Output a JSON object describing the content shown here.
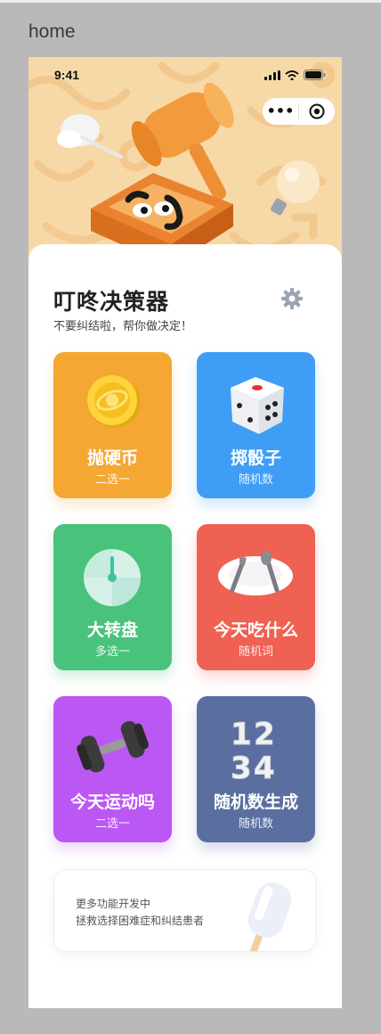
{
  "frame": {
    "label": "home"
  },
  "status_bar": {
    "time": "9:41"
  },
  "capsule": {
    "more_label": "•••"
  },
  "header": {
    "title": "叮咚决策器",
    "subtitle": "不要纠结啦，帮你做决定！"
  },
  "cards": [
    {
      "name": "抛硬币",
      "desc": "二选一",
      "color": "#f5a734",
      "icon": "coin-icon"
    },
    {
      "name": "掷骰子",
      "desc": "随机数",
      "color": "#3f9df5",
      "icon": "dice-icon"
    },
    {
      "name": "大转盘",
      "desc": "多选一",
      "color": "#49c37c",
      "icon": "wheel-icon"
    },
    {
      "name": "今天吃什么",
      "desc": "随机词",
      "color": "#ef6152",
      "icon": "plate-icon"
    },
    {
      "name": "今天运动吗",
      "desc": "二选一",
      "color": "#bb57f3",
      "icon": "dumbbell-icon"
    },
    {
      "name": "随机数生成",
      "desc": "随机数",
      "color": "#5a6fa0",
      "icon": "numbers-icon"
    }
  ],
  "more": {
    "line1": "更多功能开发中",
    "line2": "拯救选择困难症和纠结患者",
    "icon": "popsicle-icon"
  },
  "icons": {
    "settings": "gear-icon",
    "hero": "gavel-icon"
  }
}
